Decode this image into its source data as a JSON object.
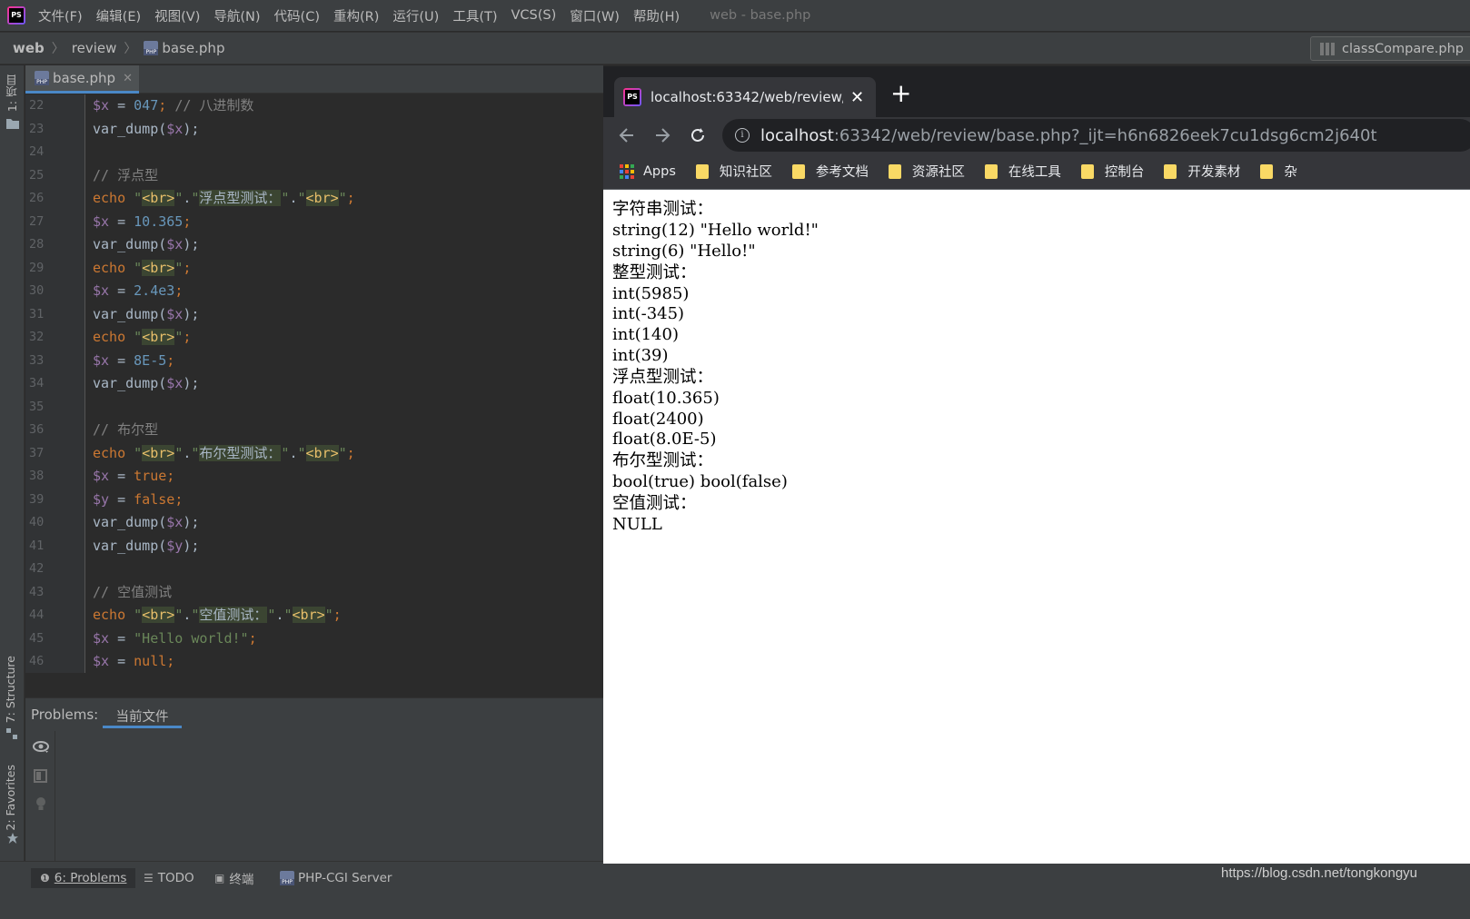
{
  "menubar": {
    "items": [
      "文件(F)",
      "编辑(E)",
      "视图(V)",
      "导航(N)",
      "代码(C)",
      "重构(R)",
      "运行(U)",
      "工具(T)",
      "VCS(S)",
      "窗口(W)",
      "帮助(H)"
    ],
    "window_title": "web - base.php"
  },
  "navbar": {
    "crumbs": [
      "web",
      "review",
      "base.php"
    ],
    "run_config": "classCompare.php"
  },
  "left_stripe": {
    "project": "1: 项目",
    "structure": "7: Structure",
    "favorites": "2: Favorites"
  },
  "editor": {
    "tab_label": "base.php",
    "line_numbers": [
      "22",
      "23",
      "24",
      "25",
      "26",
      "27",
      "28",
      "29",
      "30",
      "31",
      "32",
      "33",
      "34",
      "35",
      "36",
      "37",
      "38",
      "39",
      "40",
      "41",
      "42",
      "43",
      "44",
      "45",
      "46"
    ],
    "code": {
      "l22_a": "$x",
      "l22_b": " = ",
      "l22_c": "047",
      "l22_d": "; ",
      "l22_e": "// 八进制数",
      "var_dump_x": "var_dump(",
      "var_x": "$x",
      "close": ");",
      "float_comment": "// 浮点型",
      "echo": "echo ",
      "quote": "\"",
      "br": "<br>",
      "dot": ".",
      "semi": ";",
      "float_label": "浮点型测试：",
      "x_assign": " = ",
      "v_10365": "10.365",
      "v_24e3": "2.4e3",
      "v_8e5": "8E-5",
      "bool_comment": "// 布尔型",
      "bool_label": "布尔型测试：",
      "v_true": "true",
      "var_y": "$y",
      "v_false": "false",
      "null_comment": "// 空值测试",
      "null_label": "空值测试：",
      "v_hello": "\"Hello world!\"",
      "v_null": "null"
    }
  },
  "problems": {
    "label": "Problems:",
    "tab": "当前文件"
  },
  "statusbar": {
    "problems": "6: Problems",
    "todo": "TODO",
    "terminal": "终端",
    "server": "PHP-CGI Server"
  },
  "browser": {
    "tab_title": "localhost:63342/web/review/base.php?_ijt=h6n6826eek7cu1dsg6cm2j640t",
    "url_host": "localhost",
    "url_rest": ":63342/web/review/base.php?_ijt=h6n6826eek7cu1dsg6cm2j640t",
    "bookmarks": [
      "Apps",
      "知识社区",
      "参考文档",
      "资源社区",
      "在线工具",
      "控制台",
      "开发素材",
      "杂"
    ]
  },
  "page_output": [
    "字符串测试：",
    "string(12) \"Hello world!\"",
    "string(6) \"Hello!\"",
    "整型测试：",
    "int(5985)",
    "int(-345)",
    "int(140)",
    "int(39)",
    "浮点型测试：",
    "float(10.365)",
    "float(2400)",
    "float(8.0E-5)",
    "布尔型测试：",
    "bool(true) bool(false)",
    "空值测试：",
    "NULL"
  ],
  "watermark": "https://blog.csdn.net/tongkongyu",
  "colors": {
    "ide_bg": "#2b2b2b",
    "panel_bg": "#3c3f41",
    "accent": "#4a88c7",
    "keyword": "#cc7832",
    "string": "#6a8759",
    "variable": "#9876aa",
    "number": "#6897bb"
  }
}
